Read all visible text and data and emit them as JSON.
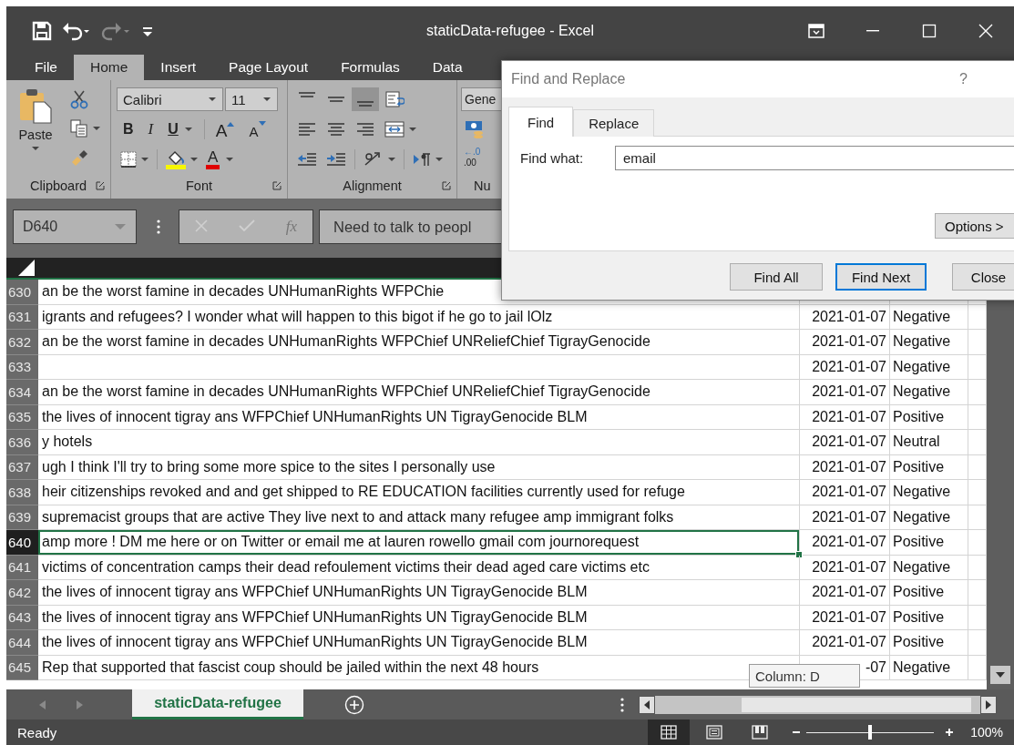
{
  "title_bar": {
    "title": "staticData-refugee - Excel",
    "quick_access": [
      {
        "kind": "save",
        "disabled": false
      },
      {
        "kind": "undo",
        "disabled": false
      },
      {
        "kind": "redo",
        "disabled": true
      },
      {
        "kind": "customize",
        "disabled": false
      }
    ]
  },
  "ribbon_tabs": [
    {
      "label": "File",
      "selected": false
    },
    {
      "label": "Home",
      "selected": true
    },
    {
      "label": "Insert",
      "selected": false
    },
    {
      "label": "Page Layout",
      "selected": false
    },
    {
      "label": "Formulas",
      "selected": false
    },
    {
      "label": "Data",
      "selected": false
    }
  ],
  "ribbon": {
    "clipboard": {
      "label": "Clipboard",
      "paste_label": "Paste"
    },
    "font": {
      "label": "Font",
      "name": "Calibri",
      "size": "11",
      "style_buttons": [
        {
          "kind": "bold",
          "label": "B"
        },
        {
          "kind": "italic",
          "label": "I"
        },
        {
          "kind": "underline",
          "label": "U"
        }
      ],
      "size_buttons": [
        {
          "kind": "grow",
          "label": "A"
        },
        {
          "kind": "shrink",
          "label": "A"
        }
      ],
      "font_color_label": "A"
    },
    "alignment": {
      "label": "Alignment",
      "vertical": [
        {
          "kind": "top",
          "pressed": false
        },
        {
          "kind": "middle",
          "pressed": false
        },
        {
          "kind": "bottom",
          "pressed": true
        }
      ]
    },
    "number": {
      "label": "Nu",
      "format": "Gene",
      "decimal_lines": [
        "←.0",
        ".00"
      ]
    }
  },
  "formula_bar": {
    "name_box": "D640",
    "function_label": "fx",
    "formula": "Need to talk to peopl"
  },
  "sheet": {
    "rows": [
      {
        "number": "630",
        "text": "an be the worst famine in decades UNHumanRights WFPChie",
        "selected": false
      },
      {
        "number": "631",
        "text": "igrants and refugees? I wonder what will happen to this bigot if he go to jail lOlz",
        "date": "2021-01-07",
        "sentiment": "Negative",
        "selected": false
      },
      {
        "number": "632",
        "text": "an be the worst famine in decades UNHumanRights WFPChief UNReliefChief TigrayGenocide",
        "date": "2021-01-07",
        "sentiment": "Negative",
        "selected": false
      },
      {
        "number": "633",
        "date": "2021-01-07",
        "sentiment": "Negative",
        "selected": false
      },
      {
        "number": "634",
        "text": "an be the worst famine in decades UNHumanRights WFPChief UNReliefChief TigrayGenocide",
        "date": "2021-01-07",
        "sentiment": "Negative",
        "selected": false
      },
      {
        "number": "635",
        "text": "the lives of innocent tigray ans WFPChief UNHumanRights UN TigrayGenocide BLM",
        "date": "2021-01-07",
        "sentiment": "Positive",
        "selected": false
      },
      {
        "number": "636",
        "text": "y hotels",
        "date": "2021-01-07",
        "sentiment": "Neutral",
        "selected": false
      },
      {
        "number": "637",
        "text": "ugh I think I'll try to bring some more spice to the sites I personally use",
        "date": "2021-01-07",
        "sentiment": "Positive",
        "selected": false
      },
      {
        "number": "638",
        "text": "heir citizenships revoked and and get shipped to RE EDUCATION facilities currently used for refuge",
        "date": "2021-01-07",
        "sentiment": "Negative",
        "selected": false
      },
      {
        "number": "639",
        "text": "supremacist groups that are active They live next to and attack many refugee amp immigrant folks",
        "date": "2021-01-07",
        "sentiment": "Negative",
        "selected": false
      },
      {
        "number": "640",
        "text": "amp more ! DM me here or on Twitter or email me at lauren rowello gmail com journorequest",
        "date": "2021-01-07",
        "sentiment": "Positive",
        "selected": true
      },
      {
        "number": "641",
        "text": "victims of concentration camps their dead refoulement victims their dead aged care victims etc",
        "date": "2021-01-07",
        "sentiment": "Negative",
        "selected": false
      },
      {
        "number": "642",
        "text": "the lives of innocent tigray ans WFPChief UNHumanRights UN TigrayGenocide BLM",
        "date": "2021-01-07",
        "sentiment": "Positive",
        "selected": false
      },
      {
        "number": "643",
        "text": "the lives of innocent tigray ans WFPChief UNHumanRights UN TigrayGenocide BLM",
        "date": "2021-01-07",
        "sentiment": "Positive",
        "selected": false
      },
      {
        "number": "644",
        "text": "the lives of innocent tigray ans WFPChief UNHumanRights UN TigrayGenocide BLM",
        "date": "2021-01-07",
        "sentiment": "Positive",
        "selected": false
      },
      {
        "number": "645",
        "text": "Rep that supported that fascist coup should be jailed within the next 48 hours",
        "date": "-07",
        "sentiment": "Negative",
        "selected": false
      }
    ],
    "tooltip": "Column: D"
  },
  "sheet_tabs": [
    {
      "label": "staticData-refugee",
      "selected": true
    }
  ],
  "status_bar": {
    "status": "Ready",
    "views": [
      {
        "kind": "normal",
        "selected": true
      },
      {
        "kind": "page_layout",
        "selected": false
      },
      {
        "kind": "page_break",
        "selected": false
      }
    ],
    "zoom_slider": {
      "level": 0.5
    },
    "zoom": "100%"
  },
  "dialog": {
    "title": "Find and Replace",
    "help": "?",
    "tabs": [
      {
        "label": "Find",
        "selected": true
      },
      {
        "label": "Replace",
        "selected": false
      }
    ],
    "find_label": "Find what:",
    "find_value": "email",
    "options_button": "Options >",
    "buttons": [
      {
        "label": "Find All",
        "focused": false
      },
      {
        "label": "Find Next",
        "focused": true
      },
      {
        "label": "Close",
        "focused": false
      }
    ]
  }
}
